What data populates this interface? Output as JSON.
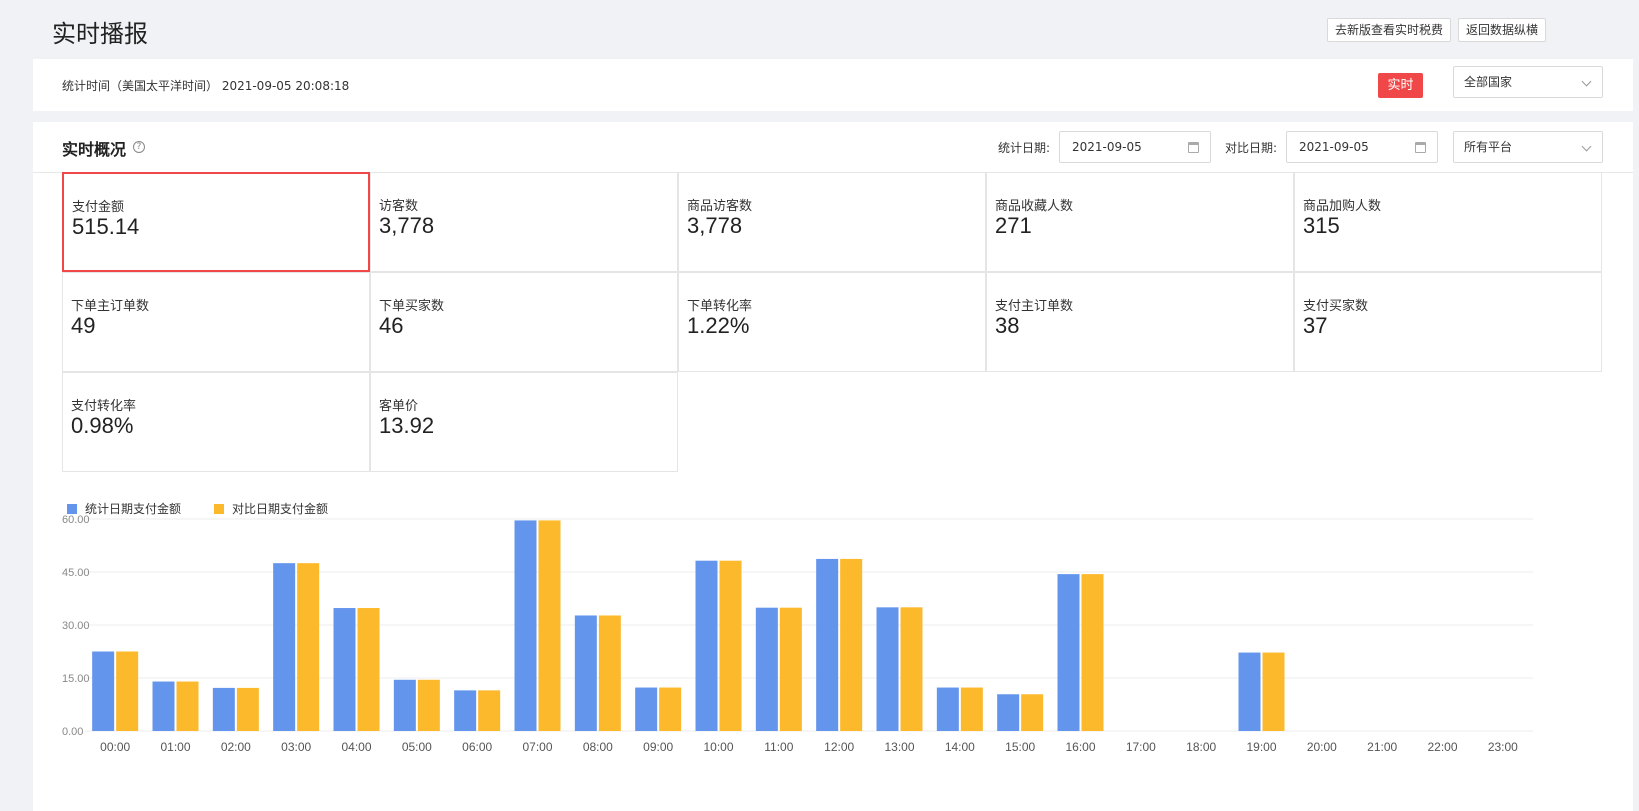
{
  "header": {
    "title": "实时播报",
    "btn_new_version": "去新版查看实时税费",
    "btn_back": "返回数据纵横"
  },
  "time_bar": {
    "stat_time": "统计时间（美国太平洋时间） 2021-09-05 20:08:18",
    "realtime_tag": "实时",
    "country_select": "全部国家"
  },
  "overview": {
    "title": "实时概况",
    "stat_date_label": "统计日期:",
    "stat_date": "2021-09-05",
    "compare_date_label": "对比日期:",
    "compare_date": "2021-09-05",
    "platform_select": "所有平台"
  },
  "metrics": [
    {
      "label": "支付金额",
      "value": "515.14"
    },
    {
      "label": "访客数",
      "value": "3,778"
    },
    {
      "label": "商品访客数",
      "value": "3,778"
    },
    {
      "label": "商品收藏人数",
      "value": "271"
    },
    {
      "label": "商品加购人数",
      "value": "315"
    },
    {
      "label": "下单主订单数",
      "value": "49"
    },
    {
      "label": "下单买家数",
      "value": "46"
    },
    {
      "label": "下单转化率",
      "value": "1.22%"
    },
    {
      "label": "支付主订单数",
      "value": "38"
    },
    {
      "label": "支付买家数",
      "value": "37"
    },
    {
      "label": "支付转化率",
      "value": "0.98%"
    },
    {
      "label": "客单价",
      "value": "13.92"
    }
  ],
  "colors": {
    "accent_red": "#f04848",
    "series_blue": "#6495ed",
    "series_yellow": "#fbb92b"
  },
  "chart_data": {
    "type": "bar",
    "categories": [
      "00:00",
      "01:00",
      "02:00",
      "03:00",
      "04:00",
      "05:00",
      "06:00",
      "07:00",
      "08:00",
      "09:00",
      "10:00",
      "11:00",
      "12:00",
      "13:00",
      "14:00",
      "15:00",
      "16:00",
      "17:00",
      "18:00",
      "19:00",
      "20:00",
      "21:00",
      "22:00",
      "23:00"
    ],
    "series": [
      {
        "name": "统计日期支付金额",
        "color": "#6495ed",
        "values": [
          22.5,
          14.0,
          12.2,
          47.5,
          34.8,
          14.5,
          11.5,
          59.6,
          32.7,
          12.3,
          48.2,
          34.9,
          48.7,
          35.0,
          12.3,
          10.4,
          44.4,
          0,
          0,
          22.2,
          0,
          0,
          0,
          0
        ]
      },
      {
        "name": "对比日期支付金额",
        "color": "#fbb92b",
        "values": [
          22.5,
          14.0,
          12.2,
          47.5,
          34.8,
          14.5,
          11.5,
          59.6,
          32.7,
          12.3,
          48.2,
          34.9,
          48.7,
          35.0,
          12.3,
          10.4,
          44.4,
          0,
          0,
          22.2,
          0,
          0,
          0,
          0
        ]
      }
    ],
    "yticks": [
      "0.00",
      "15.00",
      "30.00",
      "45.00",
      "60.00"
    ],
    "ylim": [
      0,
      60
    ],
    "grid": true,
    "legend": "top-left"
  }
}
